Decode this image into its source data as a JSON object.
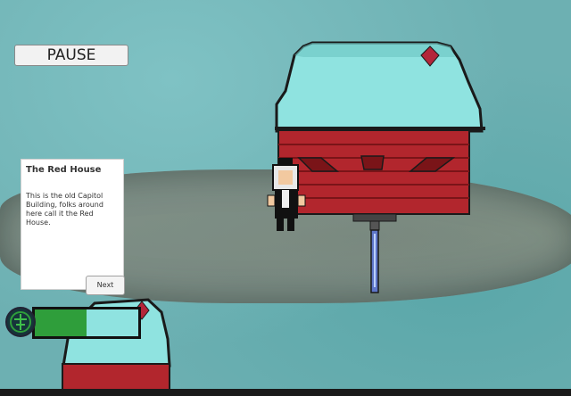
{
  "hud": {
    "pause_label": "PAUSE",
    "health_fraction": 0.5
  },
  "dialog": {
    "title": "The Red House",
    "body": "This is the old Capitol Building, folks around here call it the Red House.",
    "next_label": "Next"
  },
  "icons": {
    "health_emblem": "tree-emblem-icon"
  },
  "colors": {
    "water": "#6db0b2",
    "roof": "#8fe3e0",
    "brick": "#b2262d",
    "health_fill": "#2f9e3b"
  }
}
